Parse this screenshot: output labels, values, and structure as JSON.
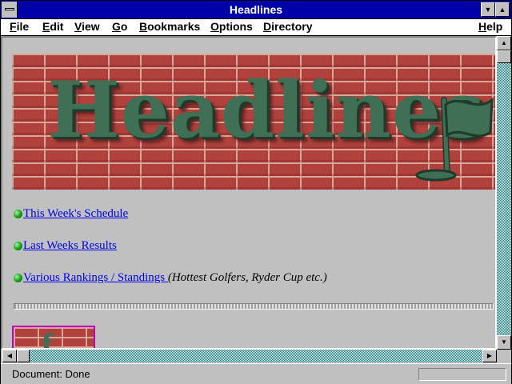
{
  "window": {
    "title": "Headlines"
  },
  "menu": {
    "items": [
      "File",
      "Edit",
      "View",
      "Go",
      "Bookmarks",
      "Options",
      "Directory"
    ],
    "help": "Help"
  },
  "page": {
    "banner_text": "Headlines",
    "links": [
      {
        "label": "This Week's Schedule"
      },
      {
        "label": "Last Weeks Results"
      },
      {
        "label": "Various Rankings / Standings ",
        "note": "(Hottest Golfers, Ryder Cup etc.)"
      }
    ]
  },
  "status": {
    "text": "Document: Done"
  },
  "colors": {
    "titlebar": "#0000a8",
    "link": "#0000ee",
    "chrome": "#c0c0c0",
    "scroll_track": "#008080"
  },
  "icons": [
    "system-menu-icon",
    "minimize-icon",
    "maximize-icon",
    "scroll-up-icon",
    "scroll-down-icon",
    "scroll-left-icon",
    "scroll-right-icon",
    "green-bullet-icon",
    "golf-flag-logo"
  ]
}
